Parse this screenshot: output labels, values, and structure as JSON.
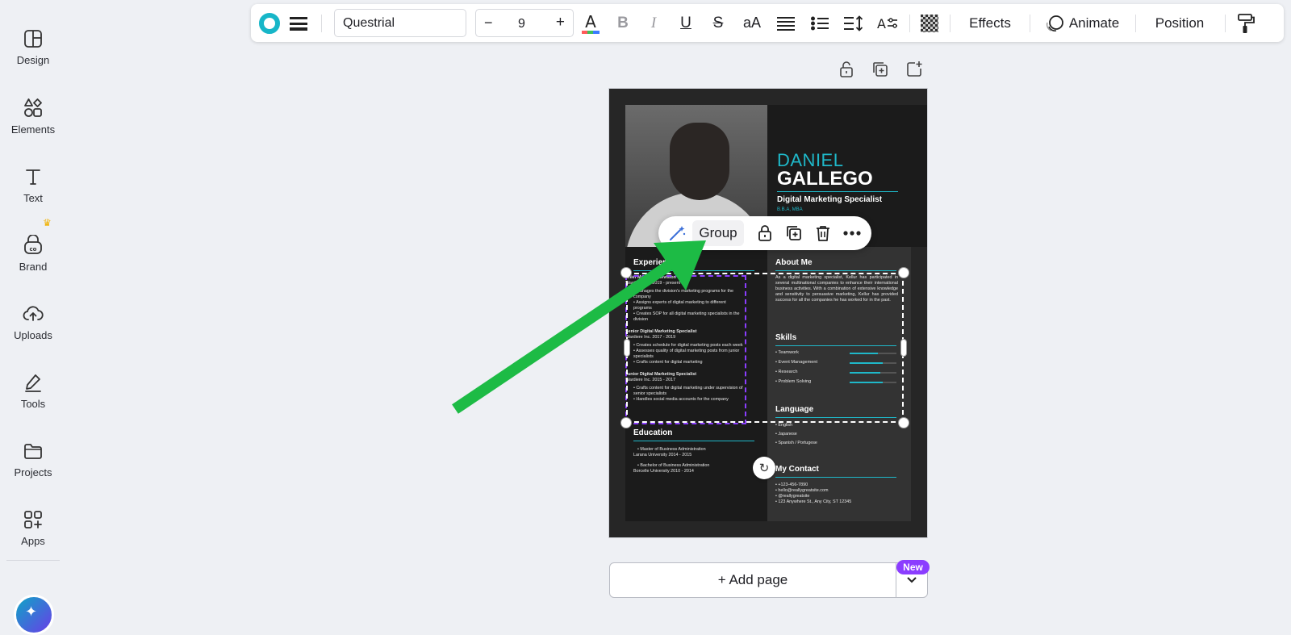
{
  "sidebar": {
    "items": [
      {
        "label": "Design",
        "icon": "design-icon"
      },
      {
        "label": "Elements",
        "icon": "elements-icon"
      },
      {
        "label": "Text",
        "icon": "text-icon"
      },
      {
        "label": "Brand",
        "icon": "brand-icon"
      },
      {
        "label": "Uploads",
        "icon": "uploads-icon"
      },
      {
        "label": "Tools",
        "icon": "tools-icon"
      },
      {
        "label": "Projects",
        "icon": "projects-icon"
      },
      {
        "label": "Apps",
        "icon": "apps-icon"
      }
    ]
  },
  "toolbar": {
    "font_name": "Questrial",
    "font_size": "9",
    "minus": "−",
    "plus": "+",
    "case_label": "aA",
    "effects_label": "Effects",
    "animate_label": "Animate",
    "position_label": "Position",
    "accent_color": "#17b6c8"
  },
  "float_bar": {
    "group_label": "Group"
  },
  "resume": {
    "first_name": "DANIEL",
    "last_name": "GALLEGO",
    "job_title": "Digital Marketing Specialist",
    "degrees": "B.B.A, MBA",
    "experience_heading": "Experience",
    "experience_lines": [
      "Chief Marketing Division",
      "Wardiere Inc. 2019 - present",
      "• Manages the division's marketing programs for the company",
      "• Assigns experts of digital marketing to different programs",
      "• Creates SOP for all digital marketing specialists in the division",
      "Senior Digital Marketing Specialist",
      "Wardiere Inc. 2017 - 2019",
      "• Creates schedule for digital marketing posts each week",
      "• Assesses quality of digital marketing posts from junior specialists",
      "• Crafts content for digital marketing",
      "Junior Digital Marketing Specialist",
      "Wardiere Inc. 2015 - 2017",
      "• Crafts content for digital marketing under supervision of senior specialists",
      "• Handles social media accounts for the company"
    ],
    "education_heading": "Education",
    "education_lines": [
      "• Master of Business Administration",
      "Larana University 2014 - 2015",
      "• Bachelor of Business Administration",
      "Borcelle University 2010 - 2014"
    ],
    "about_heading": "About Me",
    "about_text": "As a digital marketing specialist, Kellur has participated in several multinational companies to enhance their international business activities. With a combination of extensive knowledge and sensitivity to persuasive marketing, Kellur has provided success for all the companies he has worked for in the past.",
    "skills_heading": "Skills",
    "skills": [
      {
        "name": "• Teamwork",
        "level": 0.6
      },
      {
        "name": "• Event Management",
        "level": 0.7
      },
      {
        "name": "• Research",
        "level": 0.65
      },
      {
        "name": "• Problem Solving",
        "level": 0.7
      }
    ],
    "language_heading": "Language",
    "languages": [
      "• English",
      "• Japanese",
      "• Spanish / Portugese"
    ],
    "contact_heading": "My Contact",
    "contact_lines": [
      "• +123-456-7890",
      "• hello@reallygreatsite.com",
      "• @reallygreatsite",
      "• 123 Anywhere St., Any City, ST 12345"
    ]
  },
  "add_page": {
    "label": "+ Add page",
    "badge": "New"
  }
}
